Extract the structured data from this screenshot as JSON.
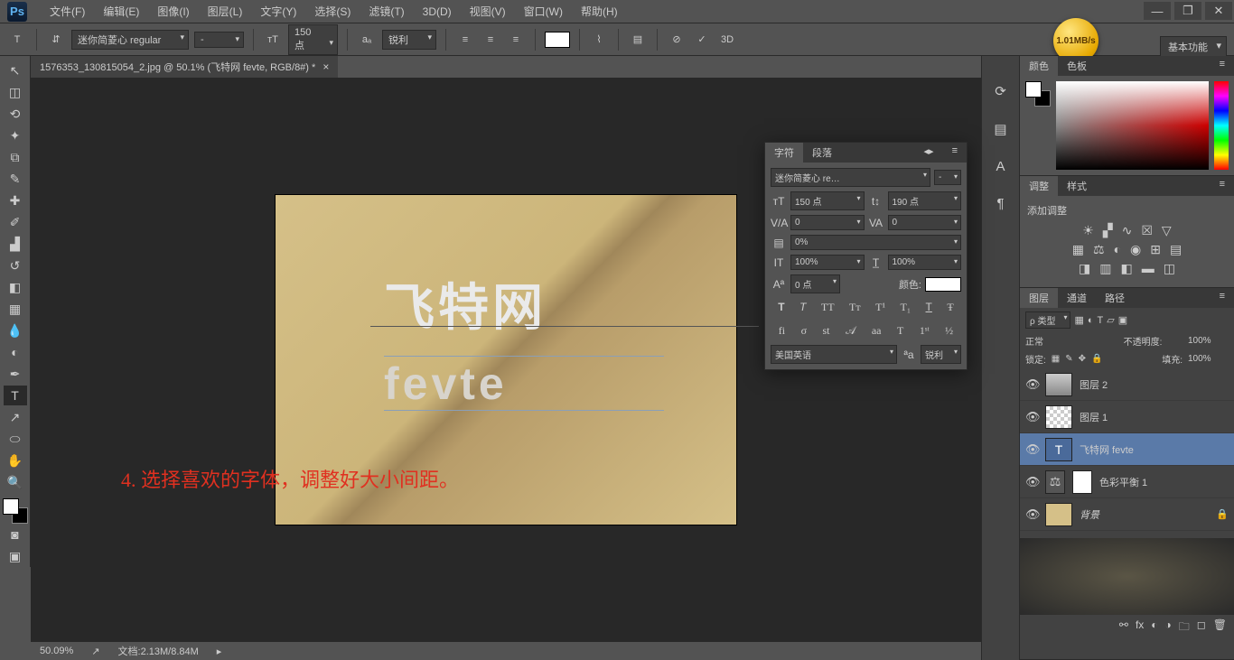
{
  "app": {
    "logo": "Ps"
  },
  "menu": [
    "文件(F)",
    "编辑(E)",
    "图像(I)",
    "图层(L)",
    "文字(Y)",
    "选择(S)",
    "滤镜(T)",
    "3D(D)",
    "视图(V)",
    "窗口(W)",
    "帮助(H)"
  ],
  "badge": "1.01MB/s",
  "workspace": "基本功能",
  "options": {
    "font": "迷你简菱心 regular",
    "style": "-",
    "size": "150 点",
    "aa": "锐利",
    "threeD": "3D"
  },
  "doc": {
    "tab": "1576353_130815054_2.jpg @ 50.1% (飞特网 fevte, RGB/8#) *",
    "text1": "飞特网",
    "text2": "fevte",
    "annotation": "4. 选择喜欢的字体，调整好大小间距。"
  },
  "status": {
    "zoom": "50.09%",
    "doc": "文档:2.13M/8.84M"
  },
  "char_panel": {
    "tabs": [
      "字符",
      "段落"
    ],
    "font": "迷你简菱心 re…",
    "style": "-",
    "size": "150 点",
    "leading": "190 点",
    "tracking_va": "0",
    "tracking": "0",
    "scale": "0%",
    "vscale": "100%",
    "hscale": "100%",
    "baseline": "0 点",
    "color_label": "颜色:",
    "lang": "美国英语",
    "aa": "锐利"
  },
  "color_panel": {
    "tabs": [
      "颜色",
      "色板"
    ]
  },
  "adjust_panel": {
    "tabs": [
      "调整",
      "样式"
    ],
    "title": "添加调整"
  },
  "layers_panel": {
    "tabs": [
      "图层",
      "通道",
      "路径"
    ],
    "kind": "ρ 类型",
    "blend": "正常",
    "opacity_label": "不透明度:",
    "opacity": "100%",
    "lock_label": "锁定:",
    "fill_label": "填充:",
    "fill": "100%",
    "layers": [
      {
        "name": "图层 2",
        "type": "raster"
      },
      {
        "name": "图层 1",
        "type": "raster"
      },
      {
        "name": "飞特网 fevte",
        "type": "text",
        "active": true
      },
      {
        "name": "色彩平衡 1",
        "type": "adjust"
      },
      {
        "name": "背景",
        "type": "bg",
        "locked": true
      }
    ]
  }
}
